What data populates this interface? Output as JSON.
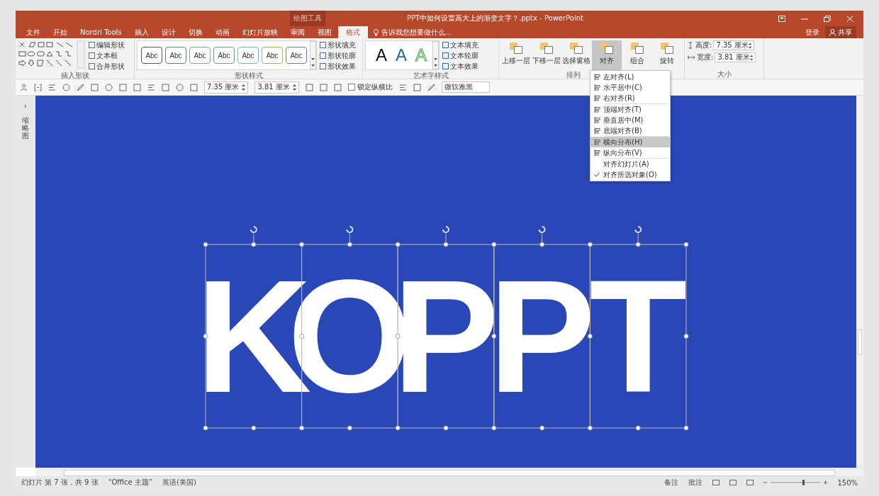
{
  "window": {
    "context_group": "绘图工具",
    "title": "PPT中如何设置高大上的渐变文字？.pptx - PowerPoint"
  },
  "tabs": [
    {
      "label": "文件",
      "selected": false
    },
    {
      "label": "开始",
      "selected": false
    },
    {
      "label": "Nordri Tools",
      "selected": false
    },
    {
      "label": "插入",
      "selected": false
    },
    {
      "label": "设计",
      "selected": false
    },
    {
      "label": "切换",
      "selected": false
    },
    {
      "label": "动画",
      "selected": false
    },
    {
      "label": "幻灯片放映",
      "selected": false
    },
    {
      "label": "审阅",
      "selected": false
    },
    {
      "label": "视图",
      "selected": false
    },
    {
      "label": "格式",
      "selected": true
    }
  ],
  "tell_me": {
    "placeholder": "告诉我您想要做什么..."
  },
  "account": {
    "sign_in": "登录",
    "share": "共享"
  },
  "ribbon": {
    "insert_shapes": {
      "commands": [
        "编辑形状",
        "文本框",
        "合并形状"
      ],
      "label": "插入形状"
    },
    "shape_styles": {
      "presets": [
        {
          "label": "Abc",
          "color": "#555555"
        },
        {
          "label": "Abc",
          "color": "#5b7ea8"
        },
        {
          "label": "Abc",
          "color": "#7fb07f"
        },
        {
          "label": "Abc",
          "color": "#5a9aa8"
        },
        {
          "label": "Abc",
          "color": "#6bb7d8"
        },
        {
          "label": "Abc",
          "color": "#8fbf55"
        },
        {
          "label": "Abc",
          "color": "#6a7fa8"
        }
      ],
      "commands": [
        "形状填充",
        "形状轮廓",
        "形状效果"
      ],
      "label": "形状样式"
    },
    "wordart_styles": {
      "presets": [
        {
          "label": "A",
          "kind": "solid"
        },
        {
          "label": "A",
          "kind": "blue"
        },
        {
          "label": "A",
          "kind": "outline"
        }
      ],
      "commands": [
        "文本填充",
        "文本轮廓",
        "文本效果"
      ],
      "label": "艺术字样式"
    },
    "arrange": {
      "commands": [
        {
          "label": "上移一层",
          "selected": false
        },
        {
          "label": "下移一层",
          "selected": false
        },
        {
          "label": "选择窗格",
          "selected": false
        },
        {
          "label": "对齐",
          "selected": true
        },
        {
          "label": "组合",
          "selected": false
        },
        {
          "label": "旋转",
          "selected": false
        }
      ],
      "label": "排列"
    },
    "size": {
      "height_label": "高度:",
      "height": "7.35 厘米",
      "width_label": "宽度:",
      "width": "3.81 厘米",
      "label": "大小"
    }
  },
  "mini_toolbar": {
    "height": "7.35 厘米",
    "width": "3.81 厘米",
    "lock_aspect": {
      "label": "锁定纵横比",
      "checked": false
    },
    "font": "微软雅黑"
  },
  "thumbnail_pane": {
    "toggle": "›",
    "label": "缩略图"
  },
  "align_menu": [
    {
      "items": [
        {
          "label": "左对齐(L)",
          "selected": false,
          "checked": false
        },
        {
          "label": "水平居中(C)",
          "selected": false,
          "checked": false
        },
        {
          "label": "右对齐(R)",
          "selected": false,
          "checked": false
        }
      ]
    },
    {
      "items": [
        {
          "label": "顶端对齐(T)",
          "selected": false,
          "checked": false
        },
        {
          "label": "垂直居中(M)",
          "selected": false,
          "checked": false
        },
        {
          "label": "底端对齐(B)",
          "selected": false,
          "checked": false
        }
      ]
    },
    {
      "items": [
        {
          "label": "横向分布(H)",
          "selected": true,
          "checked": false
        },
        {
          "label": "纵向分布(V)",
          "selected": false,
          "checked": false
        }
      ]
    },
    {
      "items": [
        {
          "label": "对齐幻灯片(A)",
          "selected": false,
          "checked": false
        },
        {
          "label": "对齐所选对象(O)",
          "selected": false,
          "checked": true
        }
      ]
    }
  ],
  "slide": {
    "letters": [
      "K",
      "O",
      "P",
      "P",
      "T"
    ]
  },
  "status_bar": {
    "slide": "幻灯片 第 7 张，共 9 张",
    "theme": "“Office 主题”",
    "language": "英语(美国)",
    "notes": "备注",
    "comments": "批注",
    "zoom": "150%"
  }
}
